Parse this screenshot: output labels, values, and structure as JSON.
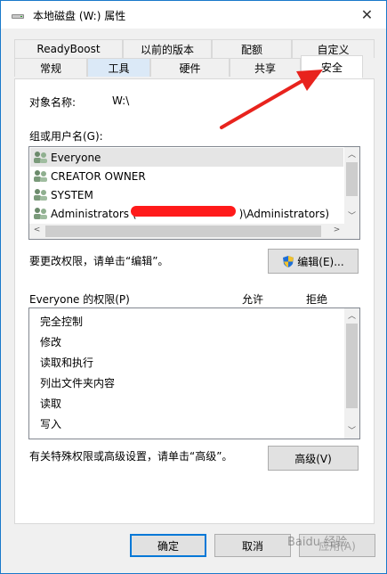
{
  "window": {
    "title": "本地磁盘 (W:) 属性",
    "close_glyph": "✕"
  },
  "tabs_row1": [
    "ReadyBoost",
    "以前的版本",
    "配额",
    "自定义"
  ],
  "tabs_row2": [
    "常规",
    "工具",
    "硬件",
    "共享",
    "安全"
  ],
  "active_tab": "安全",
  "object_name": {
    "label": "对象名称:",
    "value": "W:\\"
  },
  "users": {
    "label": "组或用户名(G):",
    "items": [
      "Everyone",
      "CREATOR OWNER",
      "SYSTEM",
      "Administrators (",
      ")\\Administrators)"
    ],
    "selected": "Everyone"
  },
  "edit_hint": "要更改权限，请单击“编辑”。",
  "edit_button": "编辑(E)...",
  "permissions": {
    "label": "Everyone 的权限(P)",
    "allow_header": "允许",
    "deny_header": "拒绝",
    "items": [
      "完全控制",
      "修改",
      "读取和执行",
      "列出文件夹内容",
      "读取",
      "写入"
    ]
  },
  "advanced_hint": "有关特殊权限或高级设置，请单击“高级”。",
  "advanced_button": "高级(V)",
  "footer": {
    "ok": "确定",
    "cancel": "取消",
    "apply": "应用(A)"
  },
  "watermark": "Baidu 经验",
  "colors": {
    "accent": "#0078d7",
    "annotation_arrow": "#e8231d",
    "redaction": "#ff1a1a"
  }
}
